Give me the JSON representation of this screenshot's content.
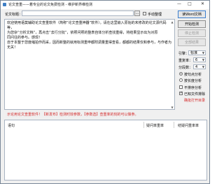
{
  "window": {
    "title": "论文查重——着专业的论文免费检测 - 维护新界维检测",
    "minimize": "—",
    "maximize": "□",
    "close": "✕"
  },
  "toolbar": {
    "file_label": "论文标题：",
    "file_value": "",
    "manual_checkbox_label": "手动整理"
  },
  "main_text": {
    "lines": [
      "欢迎使用语莫辅助论文查重软件（简称“论文查重神器”软件）。请在这里输入原始的未修改的论文源代码等，",
      "为您杂“分析文档”，再点击“去行分批”，依照问照的整表自体分析查找重缘，将结果显示出为对原",
      "同问往的参与。感现！",
      "  自于本整于您度缩拍作而采，因而新整的就用标测重申都附调量重得查看，都都的结果仅和参与，与作者为无关！"
    ]
  },
  "right_panel": {
    "open_button": "读Word文档",
    "check_button": "开始检测",
    "stop_button": "停止检测",
    "export_button": "全部结果",
    "engine_label": "引擎：",
    "engine_value": "标准",
    "threshold_label": "重复率：",
    "threshold_value": "6",
    "split_label": "分段数：",
    "split_value": "4",
    "radio_by_sentence": "按句点分析",
    "radio_by_length": "按长度分析",
    "checkbox_realtime": "不排序分析",
    "checkbox_keep": "已知文件排除",
    "link_label": "确批打开目录"
  },
  "warning_text": "示论用论文查重软件！【新发布】检测时效参数，【参数选】查重率的刻的可以做参。",
  "table": {
    "headers": [
      "语句",
      "疑问率重率",
      "结疑问重率率"
    ]
  }
}
